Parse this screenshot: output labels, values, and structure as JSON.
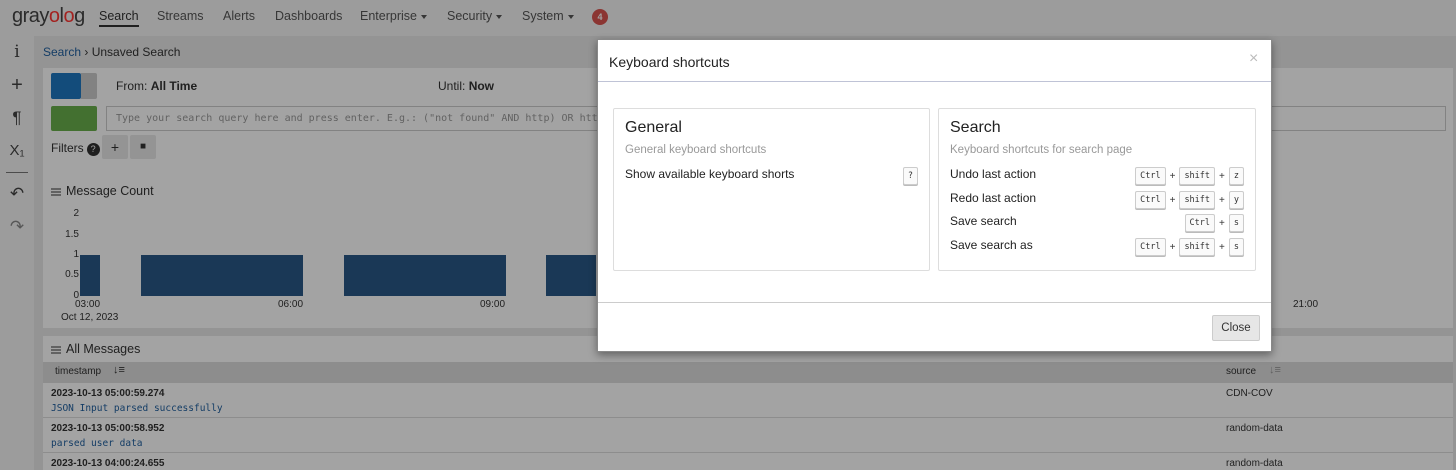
{
  "app": {
    "logo_prefix": "gray",
    "logo_o": "o",
    "logo_suffix": "g",
    "logo_l": "l"
  },
  "nav": {
    "items": [
      {
        "label": "Search",
        "active": true
      },
      {
        "label": "Streams"
      },
      {
        "label": "Alerts"
      },
      {
        "label": "Dashboards"
      },
      {
        "label": "Enterprise",
        "dropdown": true
      },
      {
        "label": "Security",
        "dropdown": true
      },
      {
        "label": "System",
        "dropdown": true
      }
    ],
    "notification_count": "4"
  },
  "rail": {
    "icons": [
      "info-icon",
      "plus-icon",
      "paragraph-icon",
      "subscript-icon",
      "undo-icon",
      "redo-icon"
    ],
    "info_glyph": "i",
    "plus_glyph": "+",
    "para_glyph": "¶",
    "sub_glyph": "X₁",
    "undo_glyph": "↶",
    "redo_glyph": "↷"
  },
  "breadcrumb": {
    "link": "Search",
    "sep": " › ",
    "current": "Unsaved Search"
  },
  "search_bar": {
    "from_label": "From:",
    "from_value": "All Time",
    "until_label": "Until:",
    "until_value": "Now",
    "query_placeholder": "Type your search query here and press enter. E.g.: (\"not found\" AND http) OR htt",
    "filters_label": "Filters",
    "help_glyph": "?",
    "add_glyph": "+",
    "folder_glyph": "■"
  },
  "message_count": {
    "title": "Message Count",
    "y_ticks": [
      "2",
      "1.5",
      "1",
      "0.5",
      "0"
    ],
    "x_ticks": [
      "03:00",
      "06:00",
      "09:00",
      "21:00"
    ],
    "x_date": "Oct 12, 2023"
  },
  "chart_data": {
    "type": "bar",
    "title": "Message Count",
    "ylim": [
      0,
      2
    ],
    "x": [
      "03:00",
      "04:00",
      "05:00",
      "06:00",
      "07:00",
      "08:00",
      "09:00",
      "10:00"
    ],
    "values": [
      1,
      0,
      1,
      1,
      0,
      1,
      1,
      0
    ]
  },
  "all_messages": {
    "title": "All Messages",
    "col_timestamp": "timestamp",
    "col_source": "source",
    "rows": [
      {
        "timestamp": "2023-10-13 05:00:59.274",
        "message": "JSON Input parsed successfully",
        "source": "CDN-COV"
      },
      {
        "timestamp": "2023-10-13 05:00:58.952",
        "message": "parsed user data",
        "source": "random-data"
      },
      {
        "timestamp": "2023-10-13 04:00:24.655",
        "message": "",
        "source": "random-data"
      }
    ]
  },
  "modal": {
    "title": "Keyboard shortcuts",
    "close_glyph": "×",
    "general": {
      "title": "General",
      "description": "General keyboard shortcuts",
      "shortcuts": [
        {
          "label": "Show available keyboard shorts",
          "keys": [
            "?"
          ]
        }
      ]
    },
    "search": {
      "title": "Search",
      "description": "Keyboard shortcuts for search page",
      "shortcuts": [
        {
          "label": "Undo last action",
          "keys": [
            "Ctrl",
            "shift",
            "z"
          ]
        },
        {
          "label": "Redo last action",
          "keys": [
            "Ctrl",
            "shift",
            "y"
          ]
        },
        {
          "label": "Save search",
          "keys": [
            "Ctrl",
            "s"
          ]
        },
        {
          "label": "Save search as",
          "keys": [
            "Ctrl",
            "shift",
            "s"
          ]
        }
      ]
    },
    "plus": "+",
    "close_button": "Close"
  }
}
